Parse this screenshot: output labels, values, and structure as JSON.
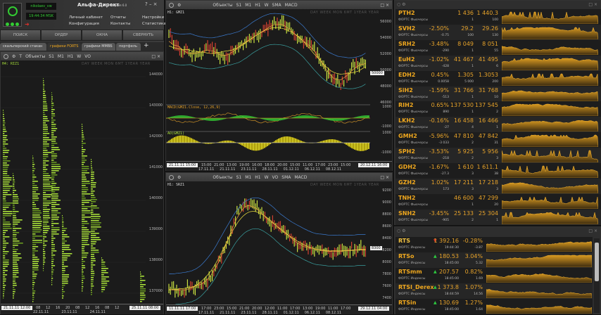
{
  "app": {
    "title": "Альфа-Директ",
    "version": "версия 6.0",
    "login": "nikolaev_vw",
    "clock": "19:44:34 MSK",
    "menu": [
      "Личный кабинет",
      "Конфигурация",
      "Отчеты",
      "Контакты",
      "Настройки",
      "Статистика"
    ],
    "buttons": [
      "ПОИСК",
      "ОРДЕР",
      "ОКНА",
      "СВЕРНУТЬ"
    ],
    "tabs": [
      "скальперский стакан",
      "графики FORTS",
      "графики ММВБ",
      "портфель"
    ]
  },
  "toolbar": {
    "objects": "Объекты",
    "items": [
      "S1",
      "M1",
      "H1",
      "W",
      "VO",
      "SMA",
      "MACD"
    ],
    "periods": "DAY WEEK MON 6MT 1YEAR YEAR"
  },
  "left_chart": {
    "header": "H4: RIZ1",
    "yaxis": [
      "144000",
      "143000",
      "142000",
      "141000",
      "140000",
      "139000",
      "138000",
      "137000"
    ],
    "start": "21.11.11 12:00",
    "end": "25.11.11 08:00",
    "times": [
      "08",
      "12",
      "16",
      "20",
      "08",
      "12",
      "16",
      "08",
      "12"
    ],
    "dates": [
      "22.11.11",
      "23.11.11",
      "24.11.11"
    ]
  },
  "mid_top_chart": {
    "header": "H1: GMZ1",
    "yaxis": [
      "56000",
      "54000",
      "52000",
      "50000",
      "48000",
      "46000"
    ],
    "last": "50000",
    "macd_label": "MACD(GMZ1.Close, 12,26,9)",
    "macd_axis": [
      "1000",
      "-1000"
    ],
    "ao_label": "AO(GMZ1)",
    "ao_axis": [
      "1000",
      "-1000"
    ],
    "start": "21.11.11 15:00",
    "end": "20.12.11 16:00",
    "times": [
      "15:00",
      "21:00",
      "13:00",
      "19:00",
      "16:00",
      "18:00",
      "20:00",
      "15:00",
      "11:00",
      "17:00",
      "23:00",
      "15:00"
    ],
    "dates": [
      "17.11.11",
      "21.11.11",
      "23.11.11",
      "28.11.11",
      "01.12.11",
      "06.12.11",
      "08.12.11"
    ]
  },
  "mid_bottom_chart": {
    "header": "H1: SRZ1",
    "yaxis": [
      "9200",
      "9000",
      "8800",
      "8600",
      "8400",
      "8200",
      "8000",
      "7800",
      "7600",
      "7400"
    ],
    "last": "8300",
    "start": "11.11.11 17:00",
    "end": "29.12.11 04:00",
    "times": [
      "17:00",
      "23:00",
      "15:00",
      "21:00",
      "20:00",
      "12:00",
      "11:00",
      "17:00",
      "13:00",
      "19:00",
      "11:00",
      "17:00"
    ],
    "dates": [
      "17.11.11",
      "21.11.11",
      "23.11.11",
      "28.11.11",
      "01.12.11",
      "06.12.11",
      "08.12.11"
    ]
  },
  "watchlist": [
    {
      "symbol": "PTH2",
      "market": "ФОРТС Фьючерсы",
      "change": "",
      "bid": "1 436",
      "ask": "1 440.3",
      "chg_abs": "",
      "bid_vol": "1",
      "ask_vol": "100"
    },
    {
      "symbol": "SVH2",
      "market": "ФОРТС Фьючерсы",
      "change": "-2.50%",
      "bid": "29.2",
      "ask": "29.26",
      "chg_abs": "-0.75",
      "bid_vol": "100",
      "ask_vol": "130"
    },
    {
      "symbol": "SRH2",
      "market": "ФОРТС Фьючерсы",
      "change": "-3.48%",
      "bid": "8 049",
      "ask": "8 051",
      "chg_abs": "-290",
      "bid_vol": "1",
      "ask_vol": "55"
    },
    {
      "symbol": "EuH2",
      "market": "ФОРТС Фьючерсы",
      "change": "-1.02%",
      "bid": "41 467",
      "ask": "41 495",
      "chg_abs": "-428",
      "bid_vol": "1",
      "ask_vol": "6"
    },
    {
      "symbol": "EDH2",
      "market": "ФОРТС Фьючерсы",
      "change": "0.45%",
      "bid": "1.305",
      "ask": "1.3053",
      "chg_abs": "0.0058",
      "bid_vol": "5 000",
      "ask_vol": "200"
    },
    {
      "symbol": "SiH2",
      "market": "ФОРТС Фьючерсы",
      "change": "-1.59%",
      "bid": "31 766",
      "ask": "31 768",
      "chg_abs": "-513",
      "bid_vol": "1",
      "ask_vol": "10"
    },
    {
      "symbol": "RIH2",
      "market": "ФОРТС Фьючерсы",
      "change": "0.65%",
      "bid": "137 530",
      "ask": "137 545",
      "chg_abs": "890",
      "bid_vol": "1",
      "ask_vol": "2"
    },
    {
      "symbol": "LKH2",
      "market": "ФОРТС Фьючерсы",
      "change": "-0.16%",
      "bid": "16 458",
      "ask": "16 466",
      "chg_abs": "-27",
      "bid_vol": "4",
      "ask_vol": "1"
    },
    {
      "symbol": "GMH2",
      "market": "ФОРТС Фьючерсы",
      "change": "-5.96%",
      "bid": "47 810",
      "ask": "47 842",
      "chg_abs": "-3 033",
      "bid_vol": "2",
      "ask_vol": "31"
    },
    {
      "symbol": "SPH2",
      "market": "ФОРТС Фьючерсы",
      "change": "-3.53%",
      "bid": "5 925",
      "ask": "5 956",
      "chg_abs": "-218",
      "bid_vol": "2",
      "ask_vol": "3"
    },
    {
      "symbol": "GDH2",
      "market": "ФОРТС Фьючерсы",
      "change": "-1.67%",
      "bid": "1 610",
      "ask": "1 611.1",
      "chg_abs": "-27.3",
      "bid_vol": "3",
      "ask_vol": "38"
    },
    {
      "symbol": "GZH2",
      "market": "ФОРТС Фьючерсы",
      "change": "1.02%",
      "bid": "17 211",
      "ask": "17 218",
      "chg_abs": "173",
      "bid_vol": "3",
      "ask_vol": "3"
    },
    {
      "symbol": "TNH2",
      "market": "ФОРТС Фьючерсы",
      "change": "",
      "bid": "46 600",
      "ask": "47 299",
      "chg_abs": "",
      "bid_vol": "1",
      "ask_vol": "20"
    },
    {
      "symbol": "SNH2",
      "market": "ФОРТС Фьючерсы",
      "change": "-3.45%",
      "bid": "25 133",
      "ask": "25 304",
      "chg_abs": "-905",
      "bid_vol": "2",
      "ask_vol": "1"
    }
  ],
  "indices": [
    {
      "symbol": "RTS",
      "market": "ФОРТС Индексы",
      "dir": "down",
      "price": "1 392.16",
      "change": "-0.28%",
      "time": "19:44:30",
      "chg_abs": "-3.87"
    },
    {
      "symbol": "RTSo",
      "market": "ФОРТС Индексы",
      "dir": "up",
      "price": "180.53",
      "change": "3.04%",
      "time": "18:45:00",
      "chg_abs": "5.32"
    },
    {
      "symbol": "RTSmm",
      "market": "ФОРТС Индексы",
      "dir": "up",
      "price": "207.57",
      "change": "0.82%",
      "time": "18:45:00",
      "chg_abs": "1.69"
    },
    {
      "symbol": "RTSI_Derex",
      "market": "ФОРТС Индексы",
      "dir": "up",
      "price": "1 373.8",
      "change": "1.07%",
      "time": "18:44:59",
      "chg_abs": "14.56"
    },
    {
      "symbol": "RTSin",
      "market": "ФОРТС Индексы",
      "dir": "up",
      "price": "130.69",
      "change": "1.27%",
      "time": "18:45:00",
      "chg_abs": "1.64"
    }
  ],
  "colors": {
    "accent": "#f0a81e",
    "up": "#2ecc40",
    "down": "#e0302a",
    "candle_up": "#a8e03a",
    "band": "#3b7bd0"
  }
}
